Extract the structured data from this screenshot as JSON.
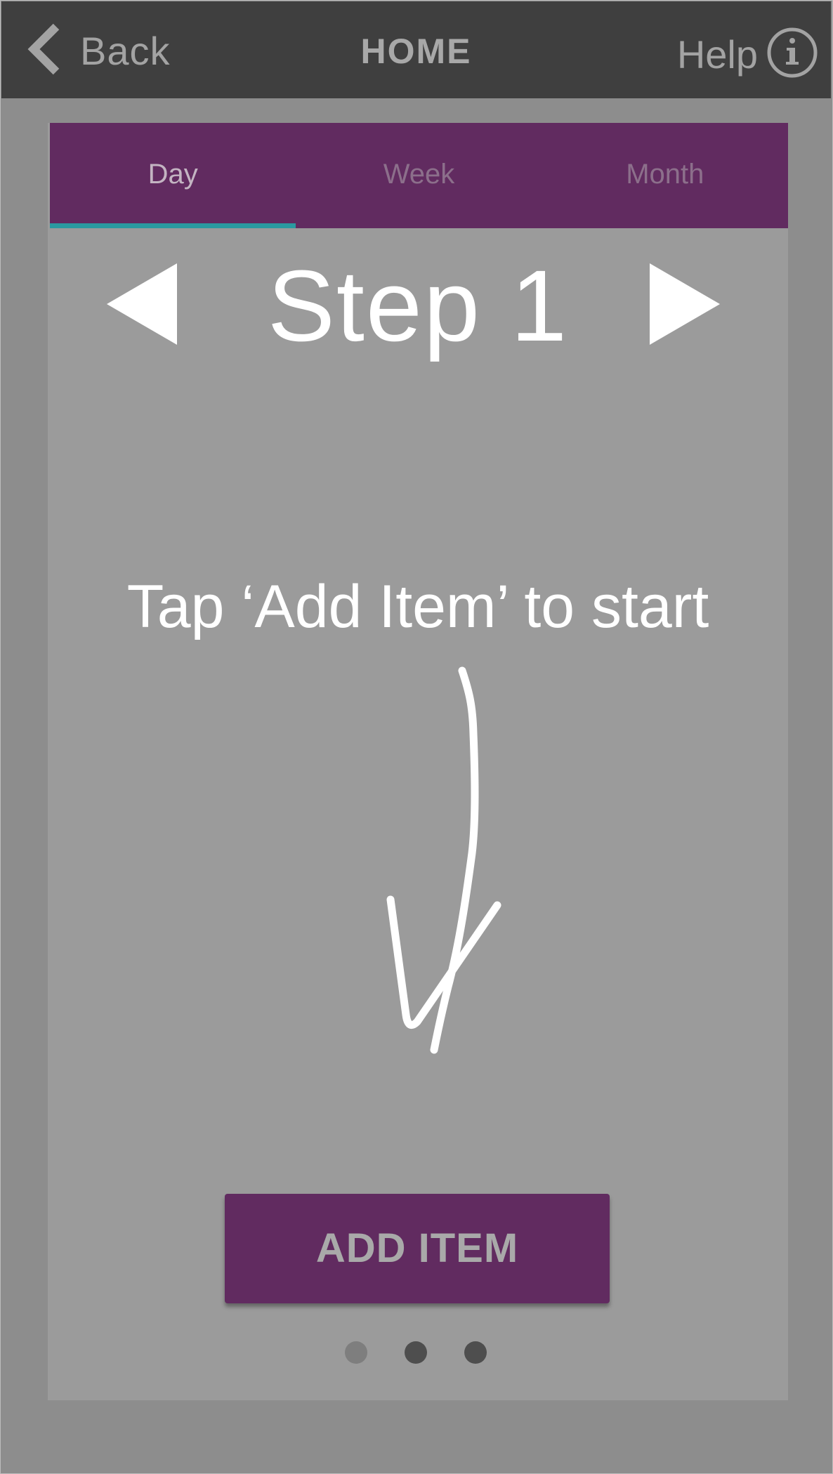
{
  "topbar": {
    "back_label": "Back",
    "title": "HOME",
    "help_label": "Help"
  },
  "tabs": [
    {
      "label": "Day",
      "active": true
    },
    {
      "label": "Week",
      "active": false
    },
    {
      "label": "Month",
      "active": false
    }
  ],
  "step": {
    "title": "Step 1"
  },
  "hint": "Tap ‘Add Item’ to start",
  "add_button_label": "ADD ITEM",
  "pager": {
    "total": 3,
    "current": 1
  },
  "colors": {
    "topbar": "#3f3f3f",
    "accent_purple": "#612b60",
    "tab_indicator": "#2a9aa0",
    "panel": "#9b9b9b",
    "background": "#8d8d8d"
  },
  "icons": [
    "chevron-left-icon",
    "info-icon",
    "triangle-left-icon",
    "triangle-right-icon",
    "hand-drawn-arrow-icon"
  ]
}
